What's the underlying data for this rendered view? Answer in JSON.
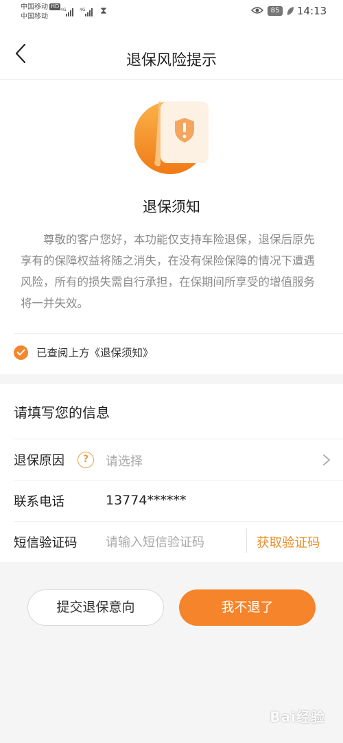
{
  "status_bar": {
    "carrier_1": "中国移动",
    "carrier_1_badge": "HD",
    "carrier_2": "中国移动",
    "battery": "85",
    "time": "14:13"
  },
  "nav": {
    "title": "退保风险提示",
    "back_icon": "chevron-left-icon"
  },
  "notice": {
    "icon": "shield-warning-icon",
    "title": "退保须知",
    "body": "尊敬的客户您好，本功能仅支持车险退保，退保后原先享有的保障权益将随之消失，在没有保险保障的情况下遭遇风险，所有的损失需自行承担，在保期间所享受的增值服务将一并失效。",
    "confirm_label": "已查阅上方《退保须知》",
    "confirmed": true
  },
  "form": {
    "title": "请填写您的信息",
    "reason": {
      "label": "退保原因",
      "help_icon": "?",
      "placeholder": "请选择"
    },
    "phone": {
      "label": "联系电话",
      "value": "13774******"
    },
    "sms": {
      "label": "短信验证码",
      "placeholder": "请输入短信验证码",
      "get_code_label": "获取验证码"
    }
  },
  "actions": {
    "submit_label": "提交退保意向",
    "stay_label": "我不退了"
  },
  "watermark": "Bai经验",
  "colors": {
    "accent": "#f5842a",
    "link": "#e8902c",
    "help": "#e5a04a"
  }
}
